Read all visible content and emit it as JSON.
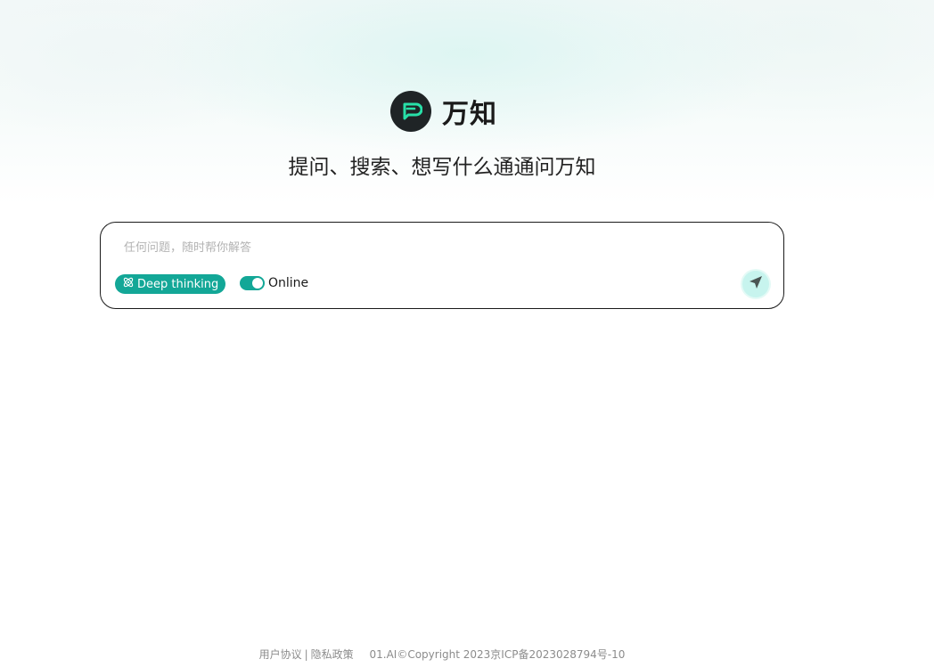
{
  "brand": {
    "name": "万知",
    "icon": "chat-bubble-p-logo",
    "logo_bg": "#1f2426",
    "logo_accent": "#28e0a8"
  },
  "tagline": "提问、搜索、想写什么通通问万知",
  "chat": {
    "placeholder": "任何问题，随时帮你解答",
    "value": "",
    "deep_thinking_label": "Deep thinking",
    "deep_thinking_icon": "atom-icon",
    "online_label": "Online",
    "online_enabled": true,
    "send_icon": "send-arrow-icon",
    "accent_color": "#13a797"
  },
  "footer": {
    "user_agreement": "用户协议",
    "separator": "|",
    "privacy_policy": "隐私政策",
    "copyright": "01.AI©Copyright 2023京ICP备2023028794号-10"
  }
}
